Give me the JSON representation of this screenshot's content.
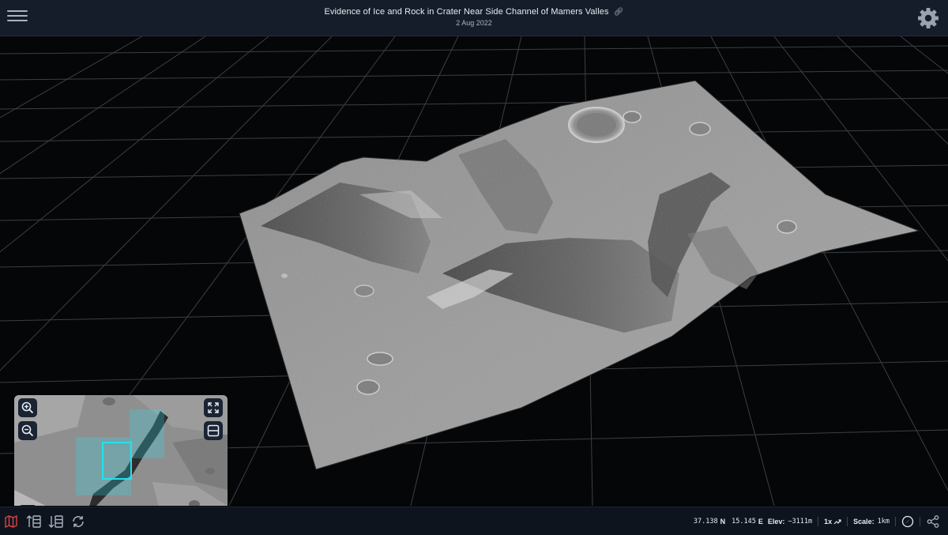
{
  "header": {
    "menu_icon": "hamburger-menu-icon",
    "title": "Evidence of Ice and Rock in Crater Near Side Channel of Mamers Valles",
    "title_link_icon": "link-icon",
    "date": "2 Aug 2022",
    "settings_icon": "gear-icon"
  },
  "minimap": {
    "zoom_in_icon": "zoom-in-icon",
    "zoom_out_icon": "zoom-out-icon",
    "fullscreen_icon": "expand-icon",
    "toggle_icon": "split-view-icon",
    "location_icon": "location-pin-icon",
    "highlight_color": "#27e0ee"
  },
  "footer": {
    "left_icons": [
      "map-icon",
      "sort-ascending-icon",
      "sort-descending-icon",
      "reset-rotate-icon"
    ],
    "lat": "37.138",
    "lat_dir": "N",
    "lon": "15.145",
    "lon_dir": "E",
    "elev_label": "Elev:",
    "elev_value": "−3111m",
    "speed": "1x",
    "scale_label": "Scale:",
    "scale_value": "1km",
    "compass_icon": "compass-icon",
    "share_icon": "share-icon"
  },
  "colors": {
    "header_bg": "#151d2a",
    "footer_bg": "#0e141e",
    "accent_cyan": "#27e0ee",
    "map_icon_red": "#d04040"
  }
}
